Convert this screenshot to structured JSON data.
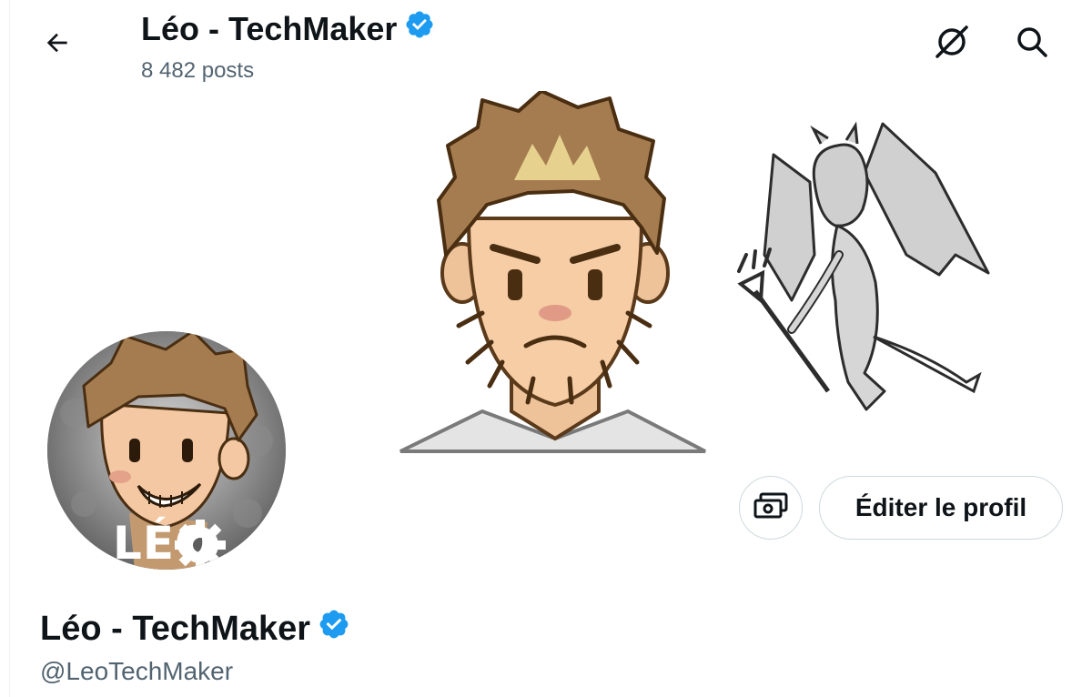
{
  "header": {
    "title": "Léo - TechMaker",
    "posts_count": "8 482 posts"
  },
  "profile": {
    "name": "Léo - TechMaker",
    "handle": "@LeoTechMaker",
    "avatar_text": "LÉO",
    "edit_label": "Éditer le profil"
  },
  "icons": {
    "back": "back-arrow-icon",
    "grok": "grok-icon",
    "search": "search-icon",
    "verified": "verified-badge-icon",
    "money": "money-icon"
  },
  "colors": {
    "verified": "#1d9bf0",
    "text_primary": "#0f1419",
    "text_secondary": "#536471",
    "border": "#cfd9de"
  }
}
